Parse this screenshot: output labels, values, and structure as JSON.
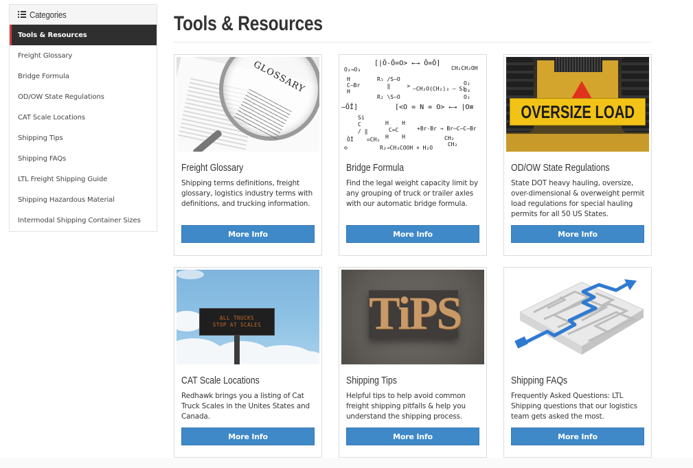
{
  "sidebar": {
    "title": "Categories",
    "icon": "list-icon",
    "items": [
      {
        "label": "Tools & Resources",
        "active": true
      },
      {
        "label": "Freight Glossary"
      },
      {
        "label": "Bridge Formula"
      },
      {
        "label": "OD/OW State Regulations"
      },
      {
        "label": "CAT Scale Locations"
      },
      {
        "label": "Shipping Tips"
      },
      {
        "label": "Shipping FAQs"
      },
      {
        "label": "LTL Freight Shipping Guide"
      },
      {
        "label": "Shipping Hazardous Material"
      },
      {
        "label": "Intermodal Shipping Container Sizes"
      }
    ]
  },
  "colors": {
    "button": "#3f89c8",
    "active_item_bg": "#2f2f2f",
    "active_item_accent": "#d9393c"
  },
  "main": {
    "title": "Tools & Resources",
    "cards": [
      {
        "title": "Freight Glossary",
        "description": "Shipping terms definitions, freight glossary, logistics industry terms with definitions, and trucking information.",
        "button": "More Info",
        "image": {
          "alt": "magnifying glass over glossary page",
          "text": "GLOSSARY"
        }
      },
      {
        "title": "Bridge Formula",
        "description": "Find the legal weight capacity limit by any grouping of truck or trailer axles with our automatic bridge formula.",
        "button": "More Info",
        "image": {
          "alt": "handwritten chemistry formulas",
          "lines": [
            "[|Ō-Ō=O> ←→ Ō=Ō]",
            "CH₂CH₂OH",
            "—CH₂O(CH₂)₃ — Si",
            "[<O = N = O> ←→ |O≡",
            "+Br·Br → Br—C—C—Br",
            "R₂→CH₃COOH + H₂O"
          ]
        }
      },
      {
        "title": "OD/OW State Regulations",
        "description": "State DOT heavy hauling, oversize, over-dimensional & overweight permit load regulations for special hauling permits for all 50 US States.",
        "button": "More Info",
        "image": {
          "alt": "oversize load sign on heavy equipment",
          "text": "OVERSIZE LOAD"
        }
      },
      {
        "title": "CAT Scale Locations",
        "description": "Redhawk brings you a listing of Cat Truck Scales in the Unites States and Canada.",
        "button": "More Info",
        "image": {
          "alt": "highway sign",
          "line1": "ALL TRUCKS",
          "line2": "STOP AT SCALES"
        }
      },
      {
        "title": "Shipping Tips",
        "description": "Helpful tips to help avoid common freight shipping pitfalls & help you understand the shipping process.",
        "button": "More Info",
        "image": {
          "alt": "letterpress tips",
          "text": "TiPS"
        }
      },
      {
        "title": "Shipping FAQs",
        "description": "Frequently Asked Questions: LTL Shipping questions that our logistics team gets asked the most.",
        "button": "More Info",
        "image": {
          "alt": "maze with blue path arrow"
        }
      }
    ]
  }
}
